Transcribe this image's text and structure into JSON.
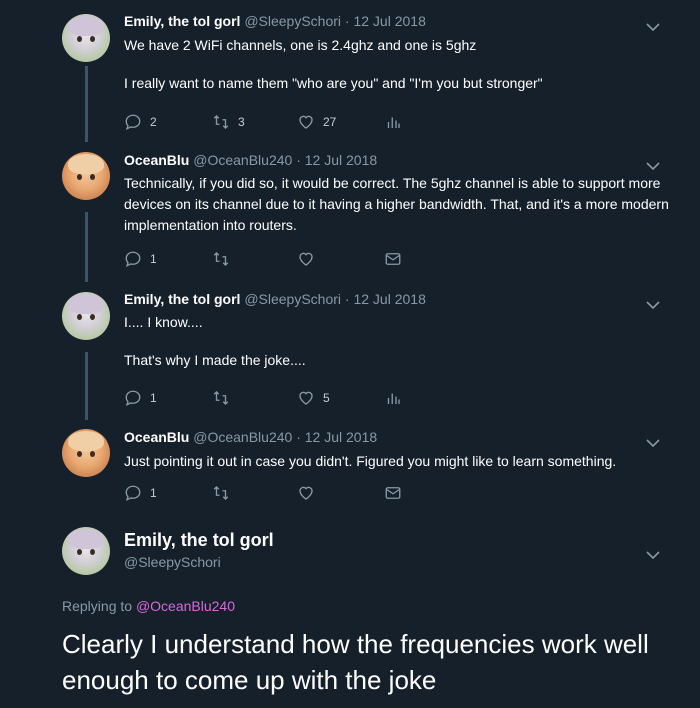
{
  "tweets": [
    {
      "name": "Emily, the tol gorl",
      "handle": "@SleepySchori",
      "date": "12 Jul 2018",
      "lines": [
        "We have 2 WiFi channels, one is 2.4ghz and one is 5ghz",
        "I really want to name them \"who are you\" and \"I'm you but stronger\""
      ],
      "reply_count": "2",
      "retweet_count": "3",
      "like_count": "27"
    },
    {
      "name": "OceanBlu",
      "handle": "@OceanBlu240",
      "date": "12 Jul 2018",
      "text": "Technically, if you did so, it would be correct. The 5ghz channel is able to support more devices on its channel due to it having a higher bandwidth. That, and it's a more modern implementation into routers.",
      "reply_count": "1"
    },
    {
      "name": "Emily, the tol gorl",
      "handle": "@SleepySchori",
      "date": "12 Jul 2018",
      "lines": [
        "I.... I know....",
        "That's why I made the joke...."
      ],
      "reply_count": "1",
      "like_count": "5"
    },
    {
      "name": "OceanBlu",
      "handle": "@OceanBlu240",
      "date": "12 Jul 2018",
      "text": "Just pointing it out in case you didn't. Figured you might like to learn something.",
      "reply_count": "1"
    }
  ],
  "main_tweet": {
    "name": "Emily, the tol gorl",
    "handle": "@SleepySchori",
    "replying_label": "Replying to",
    "replying_mention": "@OceanBlu240",
    "text": "Clearly I understand how the frequencies work well enough to come up with the joke"
  },
  "separator": "·",
  "icons": {
    "reply": "reply-icon",
    "retweet": "retweet-icon",
    "like": "heart-icon",
    "analytics": "analytics-icon",
    "message": "direct-message-icon",
    "more": "chevron-down-icon"
  },
  "colors": {
    "background": "#15202b",
    "secondary_text": "#8899a6",
    "mention": "#d56ad8",
    "thread_line": "#3d5466"
  }
}
